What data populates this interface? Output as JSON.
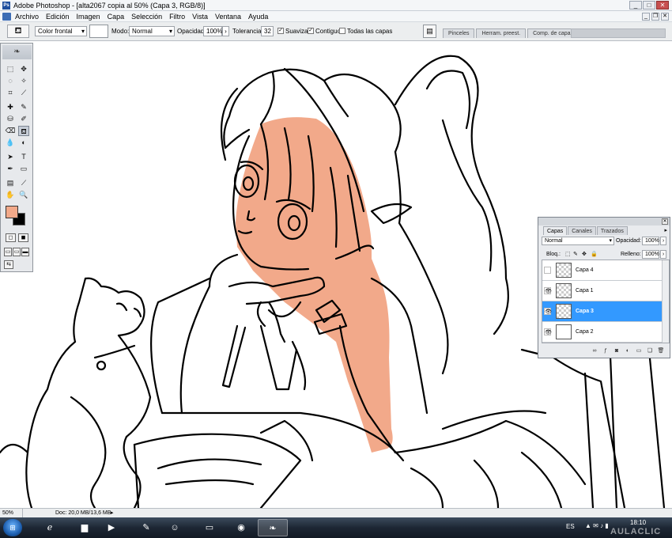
{
  "window": {
    "title": "Adobe Photoshop - [alta2067 copia al 50% (Capa 3, RGB/8)]",
    "app_icon": "photoshop-icon",
    "buttons": [
      "minimize-icon",
      "maximize-icon",
      "close-icon"
    ]
  },
  "menu": {
    "items": [
      "Archivo",
      "Edición",
      "Imagen",
      "Capa",
      "Selección",
      "Filtro",
      "Vista",
      "Ventana",
      "Ayuda"
    ]
  },
  "options": {
    "tool_icon": "paint-bucket-icon",
    "fill_source": "Color frontal",
    "mode_label": "Modo:",
    "mode_value": "Normal",
    "opacity_label": "Opacidad:",
    "opacity_value": "100%",
    "tolerance_label": "Tolerancia:",
    "tolerance_value": "32",
    "antialias_label": "Suavizar",
    "antialias_checked": true,
    "contiguous_label": "Contiguo",
    "contiguous_checked": true,
    "all_layers_label": "Todas las capas",
    "all_layers_checked": false,
    "palette_well_tabs": [
      "Pinceles",
      "Herram. preest.",
      "Comp. de capas"
    ]
  },
  "toolbox": {
    "foreground_color": "#f2a98a",
    "background_color": "#000000"
  },
  "layers_panel": {
    "tabs": [
      "Capas",
      "Canales",
      "Trazados"
    ],
    "active_tab": "Capas",
    "blend_mode": "Normal",
    "opacity_label": "Opacidad:",
    "opacity_value": "100%",
    "lock_label": "Bloq.:",
    "fill_label": "Relleno:",
    "fill_value": "100%",
    "layers": [
      {
        "name": "Capa 4",
        "visible": false,
        "selected": false
      },
      {
        "name": "Capa 1",
        "visible": true,
        "selected": false
      },
      {
        "name": "Capa 3",
        "visible": true,
        "selected": true
      },
      {
        "name": "Capa 2",
        "visible": true,
        "selected": false
      }
    ]
  },
  "status": {
    "zoom": "50%",
    "doc_info": "Doc: 20,0 MB/13,6 MB"
  },
  "taskbar": {
    "language": "ES",
    "time": "18:10",
    "watermark": "AULACLIC"
  },
  "colors": {
    "selection_blue": "#3399ff",
    "skin_fill": "#f2a98a"
  }
}
